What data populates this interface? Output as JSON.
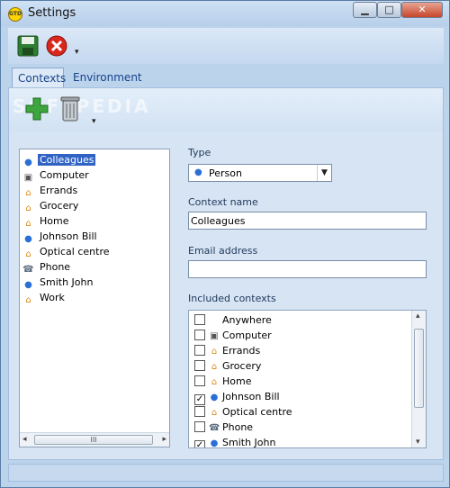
{
  "window": {
    "title": "Settings",
    "app_icon_text": "GTD",
    "buttons": {
      "minimize": "▁",
      "maximize": "□",
      "close": "✕"
    }
  },
  "toolbar": {
    "save_icon": "floppy-disk-icon",
    "cancel_icon": "cancel-icon",
    "overflow": "▾"
  },
  "tabs": [
    {
      "label": "Contexts",
      "active": true
    },
    {
      "label": "Environment",
      "active": false
    }
  ],
  "contexts_toolbar": {
    "add_icon": "plus-icon",
    "delete_icon": "trash-icon",
    "overflow": "▾",
    "watermark": "SOFTPEDIA"
  },
  "contexts": [
    {
      "label": "Colleagues",
      "icon": "person",
      "selected": true
    },
    {
      "label": "Computer",
      "icon": "computer",
      "selected": false
    },
    {
      "label": "Errands",
      "icon": "place",
      "selected": false
    },
    {
      "label": "Grocery",
      "icon": "place",
      "selected": false
    },
    {
      "label": "Home",
      "icon": "place",
      "selected": false
    },
    {
      "label": "Johnson Bill",
      "icon": "person",
      "selected": false
    },
    {
      "label": "Optical centre",
      "icon": "place",
      "selected": false
    },
    {
      "label": "Phone",
      "icon": "phone",
      "selected": false
    },
    {
      "label": "Smith John",
      "icon": "person",
      "selected": false
    },
    {
      "label": "Work",
      "icon": "place",
      "selected": false
    }
  ],
  "list_scroll": {
    "left": "◂",
    "right": "▸",
    "grip": "III"
  },
  "form": {
    "type_label": "Type",
    "type_value": "Person",
    "context_name_label": "Context name",
    "context_name_value": "Colleagues",
    "email_label": "Email address",
    "email_value": "",
    "included_label": "Included contexts"
  },
  "included_contexts": [
    {
      "label": "Anywhere",
      "icon": "",
      "checked": false
    },
    {
      "label": "Computer",
      "icon": "computer",
      "checked": false
    },
    {
      "label": "Errands",
      "icon": "place",
      "checked": false
    },
    {
      "label": "Grocery",
      "icon": "place",
      "checked": false
    },
    {
      "label": "Home",
      "icon": "place",
      "checked": false
    },
    {
      "label": "Johnson Bill",
      "icon": "person",
      "checked": true
    },
    {
      "label": "Optical centre",
      "icon": "place",
      "checked": false
    },
    {
      "label": "Phone",
      "icon": "phone",
      "checked": false
    },
    {
      "label": "Smith John",
      "icon": "person",
      "checked": true
    }
  ],
  "included_scroll": {
    "up": "▴",
    "down": "▾"
  },
  "icon_glyphs": {
    "person": "●",
    "computer": "▣",
    "place": "⌂",
    "phone": "☎"
  }
}
